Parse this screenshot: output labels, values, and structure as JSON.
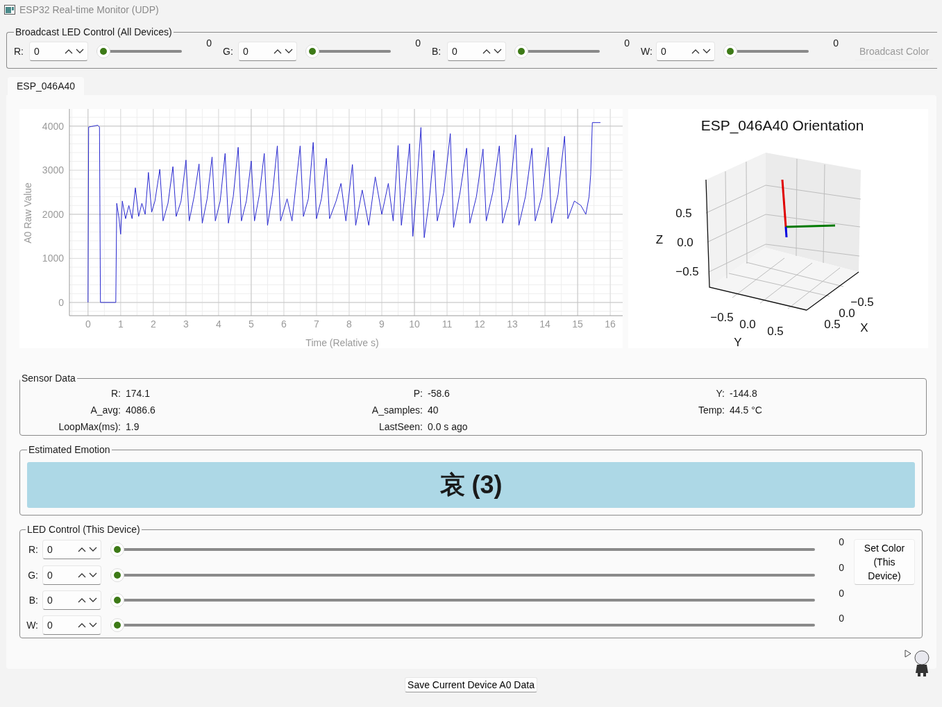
{
  "window": {
    "title": "ESP32 Real-time Monitor (UDP)"
  },
  "broadcast": {
    "title": "Broadcast LED Control (All Devices)",
    "channels": [
      {
        "label": "R:",
        "value": "0",
        "level": 0,
        "reading": "0"
      },
      {
        "label": "G:",
        "value": "0",
        "level": 0,
        "reading": "0"
      },
      {
        "label": "B:",
        "value": "0",
        "level": 0,
        "reading": "0"
      },
      {
        "label": "W:",
        "value": "0",
        "level": 0,
        "reading": "0"
      }
    ],
    "button": {
      "label": "Broadcast Color",
      "disabled": true
    }
  },
  "tabs": [
    {
      "label": "ESP_046A40",
      "selected": true
    }
  ],
  "a0_chart": {
    "chart_data": {
      "type": "line",
      "xlabel": "Time (Relative s)",
      "ylabel": "A0 Raw Value",
      "xlim": [
        -0.57,
        16.38
      ],
      "ylim": [
        -300,
        4390
      ],
      "xticks": [
        0,
        1,
        2,
        3,
        4,
        5,
        6,
        7,
        8,
        9,
        10,
        11,
        12,
        13,
        14,
        15,
        16
      ],
      "yticks": [
        0,
        1000,
        2000,
        3000,
        4000
      ],
      "x": [
        0,
        0.02,
        0.1,
        0.3,
        0.35,
        0.38,
        0.85,
        0.88,
        0.95,
        1.0,
        1.05,
        1.15,
        1.25,
        1.35,
        1.45,
        1.55,
        1.65,
        1.75,
        1.85,
        1.95,
        2.05,
        2.2,
        2.3,
        2.45,
        2.6,
        2.7,
        2.85,
        3.0,
        3.1,
        3.25,
        3.4,
        3.5,
        3.65,
        3.8,
        3.9,
        4.05,
        4.2,
        4.3,
        4.45,
        4.6,
        4.7,
        4.85,
        5.0,
        5.1,
        5.25,
        5.4,
        5.5,
        5.65,
        5.8,
        5.9,
        6.1,
        6.25,
        6.5,
        6.6,
        6.75,
        6.9,
        7.0,
        7.15,
        7.3,
        7.4,
        7.6,
        7.75,
        7.9,
        8.1,
        8.2,
        8.4,
        8.6,
        8.8,
        9.0,
        9.2,
        9.35,
        9.5,
        9.6,
        9.7,
        9.85,
        9.95,
        10.05,
        10.2,
        10.3,
        10.45,
        10.6,
        10.7,
        10.9,
        11.1,
        11.2,
        11.4,
        11.6,
        11.7,
        11.9,
        12.1,
        12.2,
        12.4,
        12.6,
        12.7,
        12.9,
        13.1,
        13.2,
        13.4,
        13.6,
        13.7,
        13.9,
        14.1,
        14.2,
        14.4,
        14.6,
        14.7,
        14.9,
        15.1,
        15.25,
        15.35,
        15.4,
        15.45,
        15.7
      ],
      "grid": true,
      "series": [
        {
          "color": "#2a2ad0",
          "values": [
            0,
            3980,
            3990,
            4020,
            3980,
            0,
            0,
            2250,
            1900,
            1550,
            2300,
            1900,
            2200,
            1900,
            2600,
            1950,
            2250,
            2000,
            2950,
            2050,
            2300,
            3020,
            1850,
            2250,
            3080,
            1950,
            2300,
            3230,
            1850,
            2400,
            3140,
            1800,
            2350,
            3300,
            1850,
            2300,
            3380,
            1800,
            2400,
            3520,
            1850,
            2300,
            3210,
            1850,
            2450,
            3380,
            1750,
            2450,
            3550,
            1850,
            2350,
            1850,
            3550,
            1950,
            2350,
            3630,
            1900,
            2350,
            3270,
            1900,
            2300,
            2700,
            1850,
            3130,
            1750,
            2550,
            1750,
            2850,
            2000,
            2700,
            1850,
            3560,
            1750,
            2400,
            3600,
            1500,
            2450,
            3970,
            1470,
            2300,
            3450,
            1850,
            2500,
            3830,
            1700,
            2500,
            3500,
            1800,
            2400,
            3480,
            1850,
            2500,
            3550,
            1800,
            2350,
            3800,
            1750,
            2400,
            3500,
            1850,
            2400,
            3520,
            1800,
            2450,
            3770,
            1900,
            2300,
            2200,
            2000,
            2400,
            2900,
            4080,
            4080
          ]
        }
      ]
    }
  },
  "orientation": {
    "title": "ESP_046A40 Orientation",
    "z_label": "Z",
    "z_ticks": [
      "0.5",
      "0.0",
      "−0.5"
    ],
    "y_label": "Y",
    "y_ticks": [
      "−0.5",
      "0.0",
      "0.5"
    ],
    "x_label": "X",
    "x_ticks": [
      "−0.5",
      "0.0",
      "0.5"
    ]
  },
  "sensor_data": {
    "title": "Sensor Data",
    "fields": [
      {
        "label": "R:",
        "value": "174.1"
      },
      {
        "label": "P:",
        "value": "-58.6"
      },
      {
        "label": "Y:",
        "value": "-144.8"
      },
      {
        "label": "A_avg:",
        "value": "4086.6"
      },
      {
        "label": "A_samples:",
        "value": "40"
      },
      {
        "label": "Temp:",
        "value": "44.5 °C"
      },
      {
        "label": "LoopMax(ms):",
        "value": "1.9"
      },
      {
        "label": "LastSeen:",
        "value": "0.0 s ago"
      }
    ]
  },
  "emotion": {
    "title": "Estimated Emotion",
    "value": "哀 (3)"
  },
  "led_control": {
    "title": "LED Control (This Device)",
    "channels": [
      {
        "label": "R:",
        "value": "0",
        "level": 0,
        "reading": "0"
      },
      {
        "label": "G:",
        "value": "0",
        "level": 0,
        "reading": "0"
      },
      {
        "label": "B:",
        "value": "0",
        "level": 0,
        "reading": "0"
      },
      {
        "label": "W:",
        "value": "0",
        "level": 0,
        "reading": "0"
      }
    ],
    "button": "Set Color (This Device)"
  },
  "save_button": "Save Current Device A0 Data"
}
